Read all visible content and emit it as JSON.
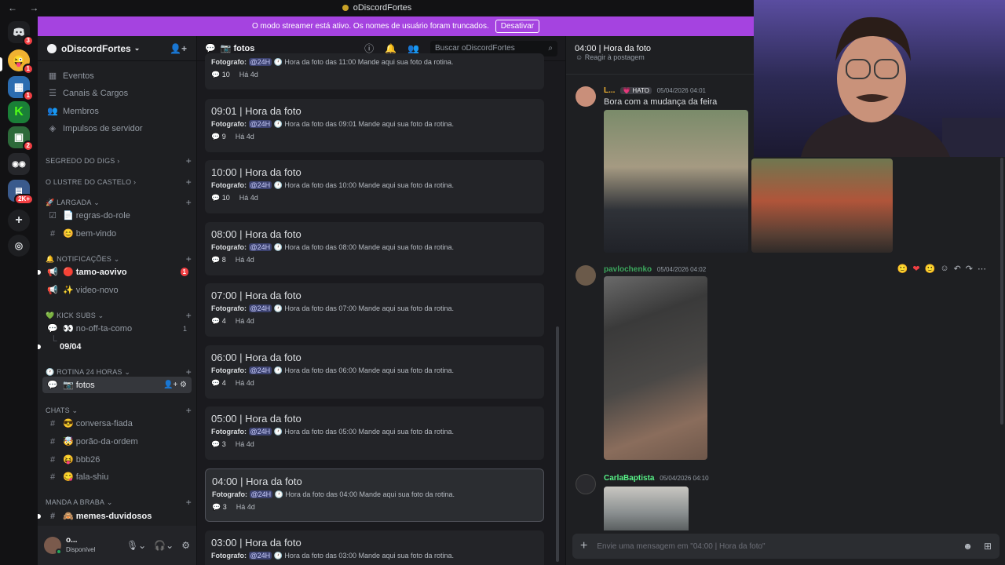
{
  "window": {
    "title": "oDiscordFortes",
    "nav": "← →"
  },
  "banner": {
    "text": "O modo streamer está ativo. Os nomes de usuário foram truncados.",
    "button": "Desativar"
  },
  "rail": {
    "badges": [
      "3",
      "1",
      "1",
      "2",
      "2K+"
    ]
  },
  "sidebar": {
    "server_name": "oDiscordFortes",
    "top_items": [
      "Eventos",
      "Canais & Cargos",
      "Membros",
      "Impulsos de servidor"
    ],
    "categories": {
      "segredo": "SEGREDO DO DIGS",
      "lustre": "O LUSTRE DO CASTELO",
      "largada": "🚀 LARGADA",
      "notificacoes": "🔔 NOTIFICAÇÕES",
      "kick": "💚 KICK SUBS",
      "rotina": "🕐 ROTINA 24 HORAS",
      "chats": "CHATS",
      "manda": "MANDA A BRABA"
    },
    "channels": {
      "regras": "📄 regras-do-role",
      "bemvindo": "😊 bem-vindo",
      "tamo": "🔴 tamo-aovivo",
      "tamo_badge": "1",
      "video": "✨ video-novo",
      "nooff": "👀 no-off-ta-como",
      "nooff_count": "1",
      "thread_0904": "09/04",
      "fotos": "📷 fotos",
      "conversa": "😎 conversa-fiada",
      "porao": "🤯 porão-da-ordem",
      "bbb": "😝 bbb26",
      "fala": "😋 fala-shiu",
      "memes": "🙈 memes-duvidosos"
    },
    "user": {
      "name": "o...",
      "status": "Disponível"
    }
  },
  "forum": {
    "channel": "📷 fotos",
    "search_placeholder": "Buscar oDiscordFortes",
    "prefix_label": "Fotografo:",
    "mention": "@24H",
    "first_partial": {
      "preview": "🕐 Hora da foto das 11:00 Mande aqui sua foto da rotina.",
      "count": "10",
      "age": "Há 4d"
    },
    "posts": [
      {
        "title": "09:01 | Hora da foto",
        "preview": "🕐 Hora da foto das 09:01 Mande aqui sua foto da rotina.",
        "count": "9",
        "age": "Há 4d"
      },
      {
        "title": "10:00 | Hora da foto",
        "preview": "🕐 Hora da foto das 10:00 Mande aqui sua foto da rotina.",
        "count": "10",
        "age": "Há 4d"
      },
      {
        "title": "08:00 | Hora da foto",
        "preview": "🕐 Hora da foto das 08:00 Mande aqui sua foto da rotina.",
        "count": "8",
        "age": "Há 4d"
      },
      {
        "title": "07:00 | Hora da foto",
        "preview": "🕐 Hora da foto das 07:00 Mande aqui sua foto da rotina.",
        "count": "4",
        "age": "Há 4d"
      },
      {
        "title": "06:00 | Hora da foto",
        "preview": "🕐 Hora da foto das 06:00 Mande aqui sua foto da rotina.",
        "count": "4",
        "age": "Há 4d"
      },
      {
        "title": "05:00 | Hora da foto",
        "preview": "🕐 Hora da foto das 05:00 Mande aqui sua foto da rotina.",
        "count": "3",
        "age": "Há 4d"
      },
      {
        "title": "04:00 | Hora da foto",
        "preview": "🕐 Hora da foto das 04:00 Mande aqui sua foto da rotina.",
        "count": "3",
        "age": "Há 4d"
      },
      {
        "title": "03:00 | Hora da foto",
        "preview": "🕐 Hora da foto das 03:00 Mande aqui sua foto da rotina.",
        "count": "",
        "age": ""
      }
    ]
  },
  "thread": {
    "title": "04:00 | Hora da foto",
    "partial_top": "Reagir à postagem",
    "messages": [
      {
        "author": "L...",
        "tag": "💗 HATO",
        "timestamp": "05/04/2026 04:01",
        "text": "Bora com a mudança da feira",
        "color": "#f0b232"
      },
      {
        "author": "pavlochenko",
        "timestamp": "05/04/2026 04:02",
        "color": "#3ba55c"
      },
      {
        "author": "CarlaBaptista",
        "timestamp": "05/04/2026 04:10",
        "color": "#57f287"
      }
    ],
    "composer_placeholder": "Envie uma mensagem em \"04:00 | Hora da foto\""
  }
}
